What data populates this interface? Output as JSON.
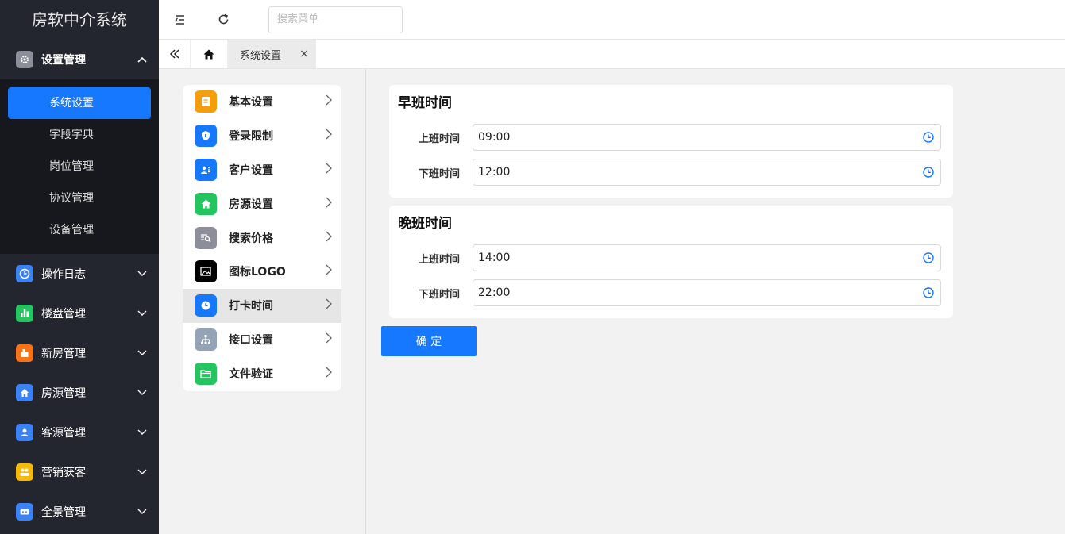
{
  "app": {
    "title": "房软中介系统"
  },
  "sidebar": {
    "open_group": {
      "label": "设置管理",
      "icon": "gear-icon",
      "color": "#8c8f99"
    },
    "subitems": [
      "系统设置",
      "字段字典",
      "岗位管理",
      "协议管理",
      "设备管理"
    ],
    "groups": [
      {
        "label": "操作日志",
        "icon": "clock-icon",
        "color": "#3b82f6"
      },
      {
        "label": "楼盘管理",
        "icon": "bar-chart-icon",
        "color": "#22c55e"
      },
      {
        "label": "新房管理",
        "icon": "building-icon",
        "color": "#f97316"
      },
      {
        "label": "房源管理",
        "icon": "home-icon",
        "color": "#3b82f6"
      },
      {
        "label": "客源管理",
        "icon": "user-icon",
        "color": "#3b82f6"
      },
      {
        "label": "营销获客",
        "icon": "group-icon",
        "color": "#f5b90b"
      },
      {
        "label": "全景管理",
        "icon": "panorama-icon",
        "color": "#3b82f6"
      }
    ]
  },
  "topbar": {
    "search_placeholder": "搜索菜单"
  },
  "tabs": {
    "active_label": "系统设置",
    "close_glyph": "×"
  },
  "settings_menu": [
    {
      "label": "基本设置",
      "icon": "document-icon",
      "color": "#f59e0b"
    },
    {
      "label": "登录限制",
      "icon": "shield-icon",
      "color": "#1677ff"
    },
    {
      "label": "客户设置",
      "icon": "contacts-icon",
      "color": "#1677ff"
    },
    {
      "label": "房源设置",
      "icon": "home-icon",
      "color": "#22c55e"
    },
    {
      "label": "搜索价格",
      "icon": "search-list-icon",
      "color": "#8c8f99"
    },
    {
      "label": "图标LOGO",
      "icon": "image-icon",
      "color": "#000000"
    },
    {
      "label": "打卡时间",
      "icon": "clock-icon",
      "color": "#1677ff",
      "active": true
    },
    {
      "label": "接口设置",
      "icon": "sitemap-icon",
      "color": "#94a3b8"
    },
    {
      "label": "文件验证",
      "icon": "folder-icon",
      "color": "#22c55e"
    }
  ],
  "shifts": {
    "morning": {
      "title": "早班时间",
      "start_label": "上班时间",
      "start": "09:00",
      "end_label": "下班时间",
      "end": "12:00"
    },
    "evening": {
      "title": "晚班时间",
      "start_label": "上班时间",
      "start": "14:00",
      "end_label": "下班时间",
      "end": "22:00"
    }
  },
  "confirm_label": "确 定"
}
